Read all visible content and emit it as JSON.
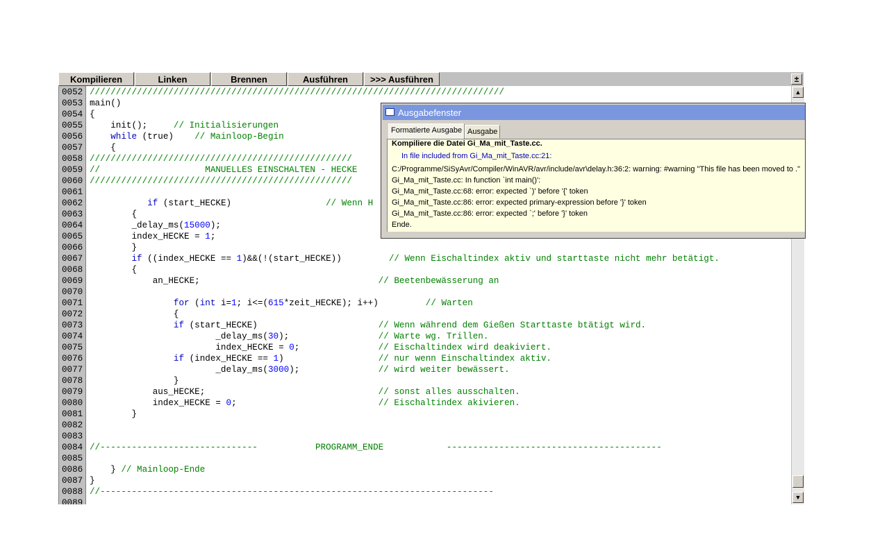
{
  "toolbar": {
    "buttons": [
      "Kompilieren",
      "Linken",
      "Brennen",
      "Ausführen",
      ">>> Ausführen"
    ],
    "corner_label": "±"
  },
  "editor": {
    "lines": [
      {
        "num": "0052",
        "code": "///////////////////////////////////////////////////////////////////////////////",
        "type": "comment"
      },
      {
        "num": "0053",
        "code": "main()",
        "type": "plain"
      },
      {
        "num": "0054",
        "code": "{",
        "type": "plain"
      },
      {
        "num": "0055",
        "code": "    init();     // Initialisierungen",
        "type": "mixed",
        "pre": "    init();     ",
        "cmt": "// Initialisierungen"
      },
      {
        "num": "0056",
        "code": "    while (true)    // Mainloop-Begin",
        "type": "mixed",
        "kw": "while",
        "pre": " (true)    ",
        "cmt": "// Mainloop-Begin",
        "indent": "    "
      },
      {
        "num": "0057",
        "code": "    {",
        "type": "plain"
      },
      {
        "num": "0058",
        "code": "//////////////////////////////////////////////////",
        "type": "comment"
      },
      {
        "num": "0059",
        "code": "//                    MANUELLES EINSCHALTEN - HECKE",
        "type": "comment"
      },
      {
        "num": "0060",
        "code": "//////////////////////////////////////////////////",
        "type": "comment"
      },
      {
        "num": "0061",
        "code": "",
        "type": "plain"
      },
      {
        "num": "0062",
        "code": "           if (start_HECKE)                  // Wenn H",
        "type": "plain"
      },
      {
        "num": "0063",
        "code": "        {",
        "type": "plain"
      },
      {
        "num": "0064",
        "code": "        _delay_ms(15000);",
        "type": "plain"
      },
      {
        "num": "0065",
        "code": "        index_HECKE = 1;",
        "type": "plain"
      },
      {
        "num": "0066",
        "code": "        }",
        "type": "plain"
      },
      {
        "num": "0067",
        "code": "        if ((index_HECKE == 1)&&(!(start_HECKE))         // Wenn Eischaltindex aktiv und starttaste nicht mehr betätigt.",
        "type": "plain"
      },
      {
        "num": "0068",
        "code": "        {",
        "type": "plain"
      },
      {
        "num": "0069",
        "code": "            an_HECKE;                                  // Beetenbewässerung an",
        "type": "plain"
      },
      {
        "num": "0070",
        "code": "",
        "type": "plain"
      },
      {
        "num": "0071",
        "code": "                for (int i=1; i<=(615*zeit_HECKE); i++)         // Warten",
        "type": "plain"
      },
      {
        "num": "0072",
        "code": "                {",
        "type": "plain"
      },
      {
        "num": "0073",
        "code": "                if (start_HECKE)                       // Wenn während dem Gießen Starttaste btätigt wird.",
        "type": "plain"
      },
      {
        "num": "0074",
        "code": "                        _delay_ms(30);                 // Warte wg. Trillen.",
        "type": "plain"
      },
      {
        "num": "0075",
        "code": "                        index_HECKE = 0;               // Eischaltindex wird deakiviert.",
        "type": "plain"
      },
      {
        "num": "0076",
        "code": "                if (index_HECKE == 1)                  // nur wenn Einschaltindex aktiv.",
        "type": "plain"
      },
      {
        "num": "0077",
        "code": "                        _delay_ms(3000);               // wird weiter bewässert.",
        "type": "plain"
      },
      {
        "num": "0078",
        "code": "                }",
        "type": "plain"
      },
      {
        "num": "0079",
        "code": "            aus_HECKE;                                 // sonst alles ausschalten.",
        "type": "plain"
      },
      {
        "num": "0080",
        "code": "            index_HECKE = 0;                           // Eischaltindex akivieren.",
        "type": "plain"
      },
      {
        "num": "0081",
        "code": "        }",
        "type": "plain"
      },
      {
        "num": "0082",
        "code": "",
        "type": "plain"
      },
      {
        "num": "0083",
        "code": "",
        "type": "plain"
      },
      {
        "num": "0084",
        "code": "//------------------------------           PROGRAMM_ENDE            -----------------------------------------",
        "type": "comment"
      },
      {
        "num": "0085",
        "code": "",
        "type": "plain"
      },
      {
        "num": "0086",
        "code": "    } // Mainloop-Ende",
        "type": "plain"
      },
      {
        "num": "0087",
        "code": "}",
        "type": "plain"
      },
      {
        "num": "0088",
        "code": "//---------------------------------------------------------------------------",
        "type": "comment"
      },
      {
        "num": "0089",
        "code": "",
        "type": "plain"
      }
    ]
  },
  "popup": {
    "title": "Ausgabefenster",
    "tabs": [
      "Formatierte Ausgabe",
      "Ausgabe"
    ],
    "output": [
      {
        "text": "Kompiliere die Datei Gi_Ma_mit_Taste.cc.",
        "style": "bold"
      },
      {
        "text": "In file included  from Gi_Ma_mit_Taste.cc:21:",
        "style": "blue"
      },
      {
        "text": "C:/Programme/SiSyAvr/Compiler/WinAVR/avr/include/avr\\delay.h:36:2: warning: #warning \"This file has been moved to .\"",
        "style": "normal"
      },
      {
        "text": "Gi_Ma_mit_Taste.cc: In function `int main()':",
        "style": "normal"
      },
      {
        "text": "Gi_Ma_mit_Taste.cc:68: error: expected `)' before '{' token",
        "style": "normal"
      },
      {
        "text": "Gi_Ma_mit_Taste.cc:86: error: expected primary-expression before '}' token",
        "style": "normal"
      },
      {
        "text": "Gi_Ma_mit_Taste.cc:86: error: expected `;' before '}' token",
        "style": "normal"
      },
      {
        "text": "Ende.",
        "style": "normal"
      }
    ]
  }
}
